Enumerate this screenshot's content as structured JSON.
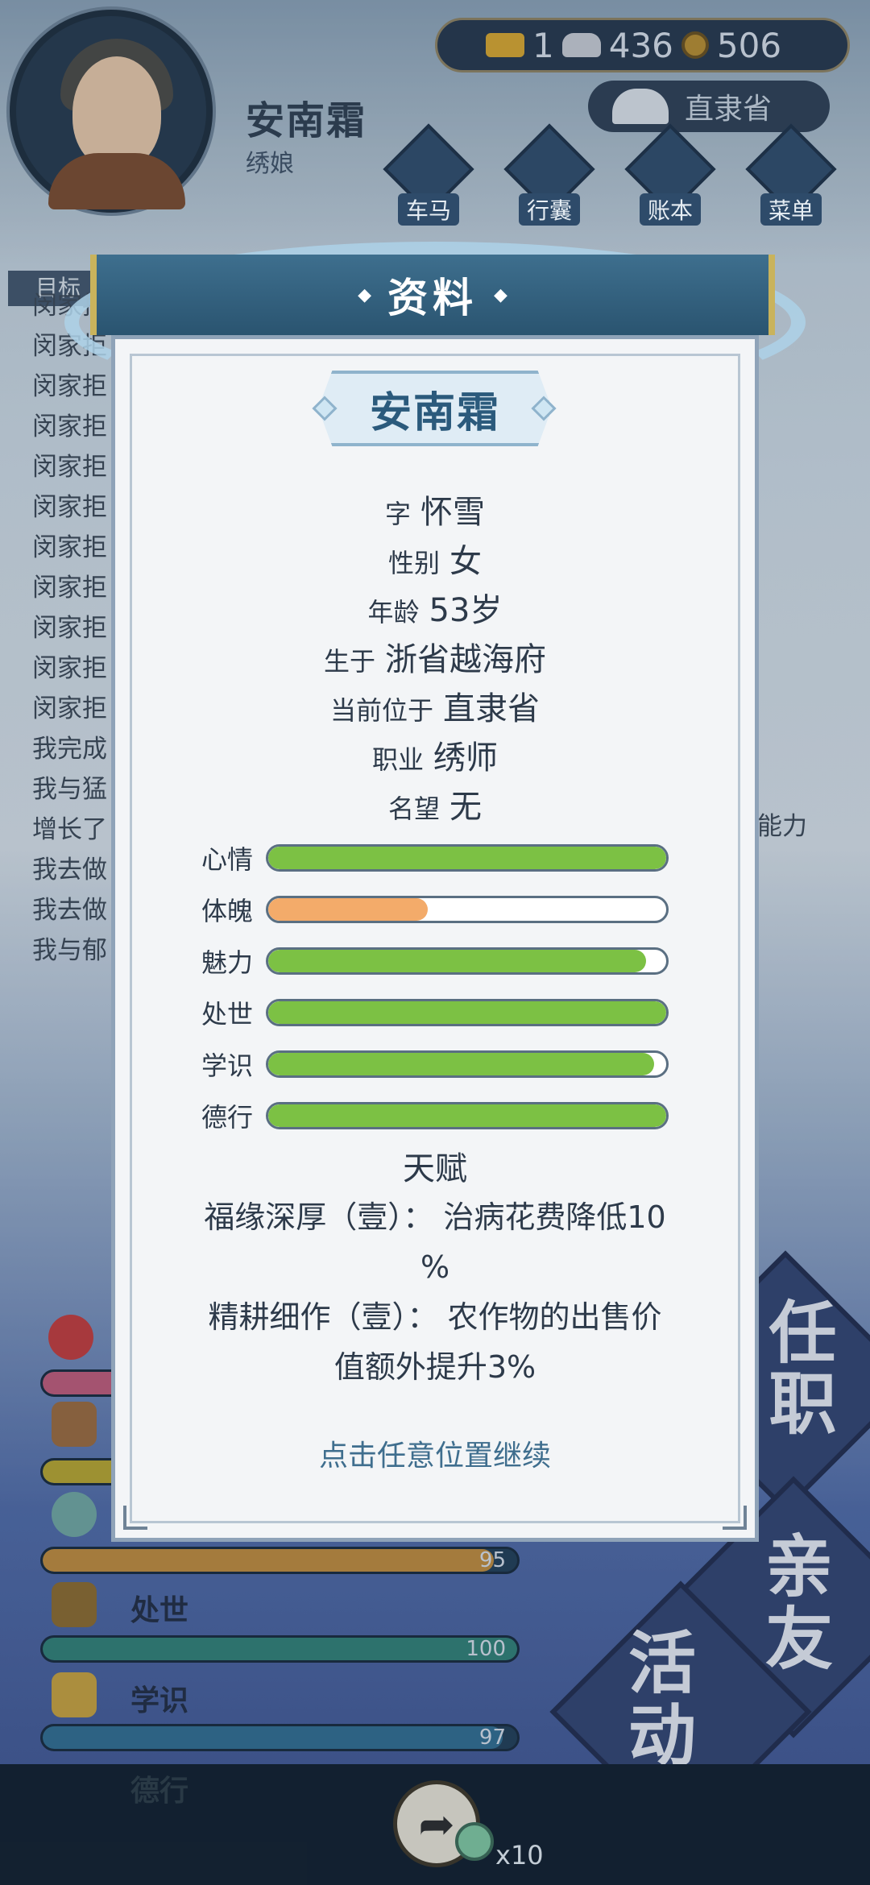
{
  "player": {
    "name": "安南霜",
    "job": "绣娘"
  },
  "currency": {
    "gold": "1",
    "silver": "436",
    "coins": "506"
  },
  "location": "直隶省",
  "top_menu": [
    "车马",
    "行囊",
    "账本",
    "菜单"
  ],
  "target_label": "目标",
  "log_entries": [
    "闵家拒",
    "闵家拒",
    "闵家拒",
    "闵家拒",
    "闵家拒",
    "闵家拒",
    "闵家拒",
    "闵家拒",
    "闵家拒",
    "闵家拒",
    "闵家拒",
    "我完成",
    "我与猛",
    "增长了",
    "我去做",
    "我去做",
    "我与郁"
  ],
  "log_overflow": "能力",
  "background_stats": [
    {
      "name": "处世",
      "value": "100",
      "fraction": 1.0,
      "color": "#2f7f75"
    },
    {
      "name": "学识",
      "value": "97",
      "fraction": 0.97,
      "color": "#2f6c8f"
    },
    {
      "name": "德行",
      "value": "",
      "fraction": 1.0,
      "color": "#5a1e3a"
    }
  ],
  "background_extra_value": "95",
  "side_buttons": [
    "任职",
    "亲友",
    "活动"
  ],
  "share_count": "x10",
  "dialog": {
    "title": "资料",
    "name": "安南霜",
    "info": [
      {
        "key": "字",
        "value": "怀雪"
      },
      {
        "key": "性别",
        "value": "女"
      },
      {
        "key": "年龄",
        "value": "53岁"
      },
      {
        "key": "生于",
        "value": "浙省越海府"
      },
      {
        "key": "当前位于",
        "value": "直隶省"
      },
      {
        "key": "职业",
        "value": "绣师"
      },
      {
        "key": "名望",
        "value": "无"
      }
    ],
    "attributes": [
      {
        "name": "心情",
        "fraction": 1.0,
        "color": "#7cc144"
      },
      {
        "name": "体魄",
        "fraction": 0.4,
        "color": "#f3ab6a"
      },
      {
        "name": "魅力",
        "fraction": 0.95,
        "color": "#7cc144"
      },
      {
        "name": "处世",
        "fraction": 1.0,
        "color": "#7cc144"
      },
      {
        "name": "学识",
        "fraction": 0.97,
        "color": "#7cc144"
      },
      {
        "name": "德行",
        "fraction": 1.0,
        "color": "#7cc144"
      }
    ],
    "talent_title": "天赋",
    "talents": [
      {
        "line1": "福缘深厚（壹）： 治病花费降低10",
        "line2": "%"
      },
      {
        "line1": "精耕细作（壹）： 农作物的出售价",
        "line2": "值额外提升3%"
      }
    ],
    "continue_hint": "点击任意位置继续"
  }
}
